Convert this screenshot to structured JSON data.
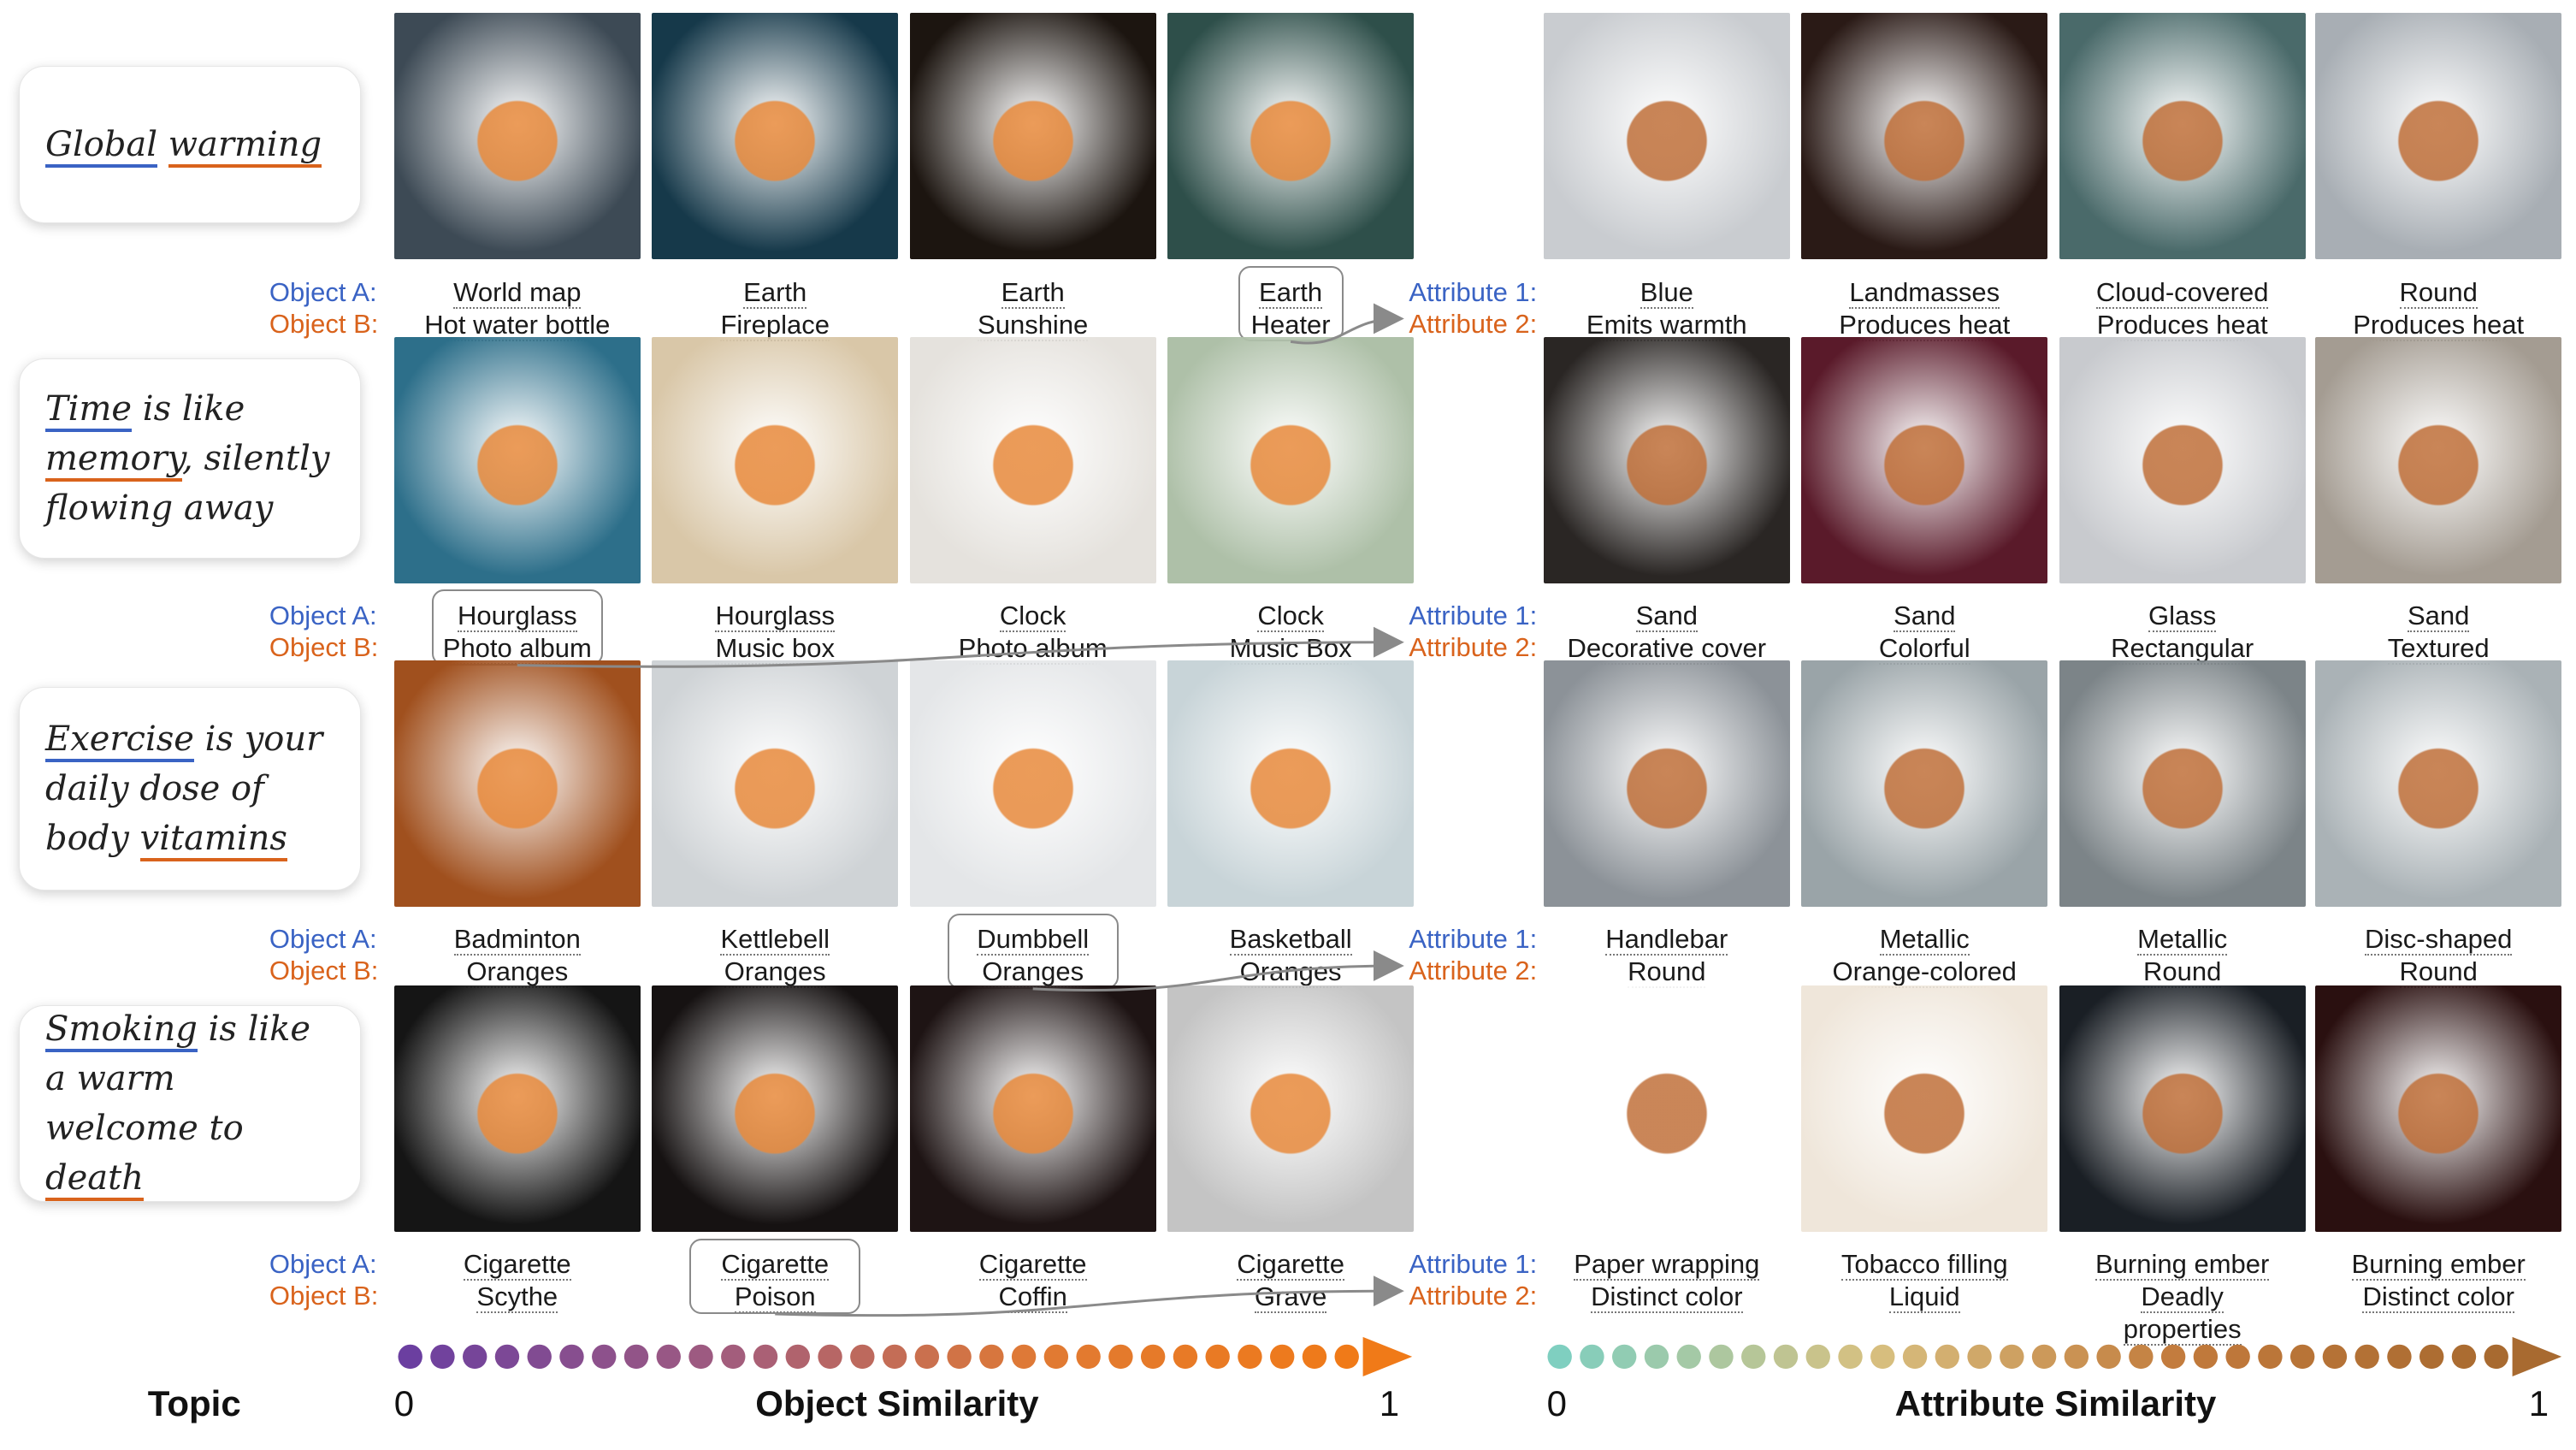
{
  "labels": {
    "object_a": "Object A:",
    "object_b": "Object B:",
    "attribute_1": "Attribute 1:",
    "attribute_2": "Attribute 2:"
  },
  "rows": [
    {
      "topic": [
        {
          "text": "Global",
          "u": "blue"
        },
        {
          "text": " "
        },
        {
          "text": "warming",
          "u": "orange"
        }
      ],
      "objects": [
        {
          "a": "World map",
          "b": "Hot water bottle",
          "icon": "bottle-map-icon",
          "bg": "#3d4a55"
        },
        {
          "a": "Earth",
          "b": "Fireplace",
          "icon": "earth-fireplace-icon",
          "bg": "#16394a"
        },
        {
          "a": "Earth",
          "b": "Sunshine",
          "icon": "earth-sun-icon",
          "bg": "#1c1510"
        },
        {
          "a": "Earth",
          "b": "Heater",
          "icon": "earth-heater-icon",
          "bg": "#2e4f4a"
        }
      ],
      "attributes": [
        {
          "a": "Blue",
          "b": "Emits warmth",
          "icon": "blue-flame-globe-icon",
          "bg": "#c9ccd0"
        },
        {
          "a": "Landmasses",
          "b": "Produces heat",
          "icon": "glowing-globe-icon",
          "bg": "#2a1a16"
        },
        {
          "a": "Cloud-covered",
          "b": "Produces heat",
          "icon": "burning-globe-icon",
          "bg": "#4a6a6a"
        },
        {
          "a": "Round",
          "b": "Produces heat",
          "icon": "heater-globe-icon",
          "bg": "#a8aeb4"
        }
      ],
      "highlight_index": 3,
      "extra_b": ""
    },
    {
      "topic": [
        {
          "text": "Time",
          "u": "blue"
        },
        {
          "text": " is like "
        },
        {
          "text": "memory",
          "u": "orange"
        },
        {
          "text": ", silently flowing away"
        }
      ],
      "objects": [
        {
          "a": "Hourglass",
          "b": "Photo album",
          "icon": "hourglass-album-icon",
          "bg": "#2d6f8a"
        },
        {
          "a": "Hourglass",
          "b": "Music box",
          "icon": "hourglass-musicbox-icon",
          "bg": "#d9c7a8"
        },
        {
          "a": "Clock",
          "b": "Photo album",
          "icon": "clock-album-icon",
          "bg": "#e5e2dd"
        },
        {
          "a": "Clock",
          "b": "Music Box",
          "icon": "clock-musicbox-icon",
          "bg": "#aec0a8"
        }
      ],
      "attributes": [
        {
          "a": "Sand",
          "b": "Decorative cover",
          "icon": "hourglass-book-icon",
          "bg": "#2a2624"
        },
        {
          "a": "Sand",
          "b": "Colorful",
          "icon": "hourglass-colorful-icon",
          "bg": "#5a1a2a"
        },
        {
          "a": "Glass",
          "b": "Rectangular",
          "icon": "glass-hourglass-icon",
          "bg": "#c8cace"
        },
        {
          "a": "Sand",
          "b": "Textured",
          "icon": "textured-hourglass-icon",
          "bg": "#a49c92"
        }
      ],
      "highlight_index": 0,
      "extra_b": ""
    },
    {
      "topic": [
        {
          "text": "Exercise",
          "u": "blue"
        },
        {
          "text": " is your daily dose of body "
        },
        {
          "text": "vitamins",
          "u": "orange"
        }
      ],
      "objects": [
        {
          "a": "Badminton",
          "b": "Oranges",
          "icon": "shuttlecock-orange-icon",
          "bg": "#a0501e"
        },
        {
          "a": "Kettlebell",
          "b": "Oranges",
          "icon": "kettlebell-orange-icon",
          "bg": "#cfd3d6"
        },
        {
          "a": "Dumbbell",
          "b": "Oranges",
          "icon": "dumbbell-orange-icon",
          "bg": "#e4e6e8"
        },
        {
          "a": "Basketball",
          "b": "Oranges",
          "icon": "basketball-orange-icon",
          "bg": "#c8d4d8"
        }
      ],
      "attributes": [
        {
          "a": "Handlebar",
          "b": "Round",
          "icon": "orange-handlebar-icon",
          "bg": "#8c9298"
        },
        {
          "a": "Metallic",
          "b": "Orange-colored",
          "icon": "orange-dumbbell-icon",
          "bg": "#9aa4a8"
        },
        {
          "a": "Metallic",
          "b": "Round",
          "icon": "metal-dumbbell-icon",
          "bg": "#7c8488"
        },
        {
          "a": "Disc-shaped",
          "b": "Round",
          "icon": "disc-dumbbell-icon",
          "bg": "#aab2b6"
        }
      ],
      "highlight_index": 2,
      "extra_b": ""
    },
    {
      "topic": [
        {
          "text": "Smoking",
          "u": "blue"
        },
        {
          "text": " is like a warm welcome to "
        },
        {
          "text": "death",
          "u": "orange"
        }
      ],
      "objects": [
        {
          "a": "Cigarette",
          "b": "Scythe",
          "icon": "cigarette-scythe-icon",
          "bg": "#151515"
        },
        {
          "a": "Cigarette",
          "b": "Poison",
          "icon": "cigarette-poison-icon",
          "bg": "#161212"
        },
        {
          "a": "Cigarette",
          "b": "Coffin",
          "icon": "cigarette-coffin-icon",
          "bg": "#1e1414"
        },
        {
          "a": "Cigarette",
          "b": "Grave",
          "icon": "cigarette-grave-icon",
          "bg": "#c4c4c4"
        }
      ],
      "attributes": [
        {
          "a": "Paper wrapping",
          "b": "Distinct color",
          "icon": "red-cigarettes-icon",
          "bg": "#ffffff"
        },
        {
          "a": "Tobacco filling",
          "b": "Liquid",
          "icon": "skull-cigarette-icon",
          "bg": "#efe6da"
        },
        {
          "a": "Burning ember",
          "b": "Deadly",
          "icon": "smoke-skull-icon",
          "bg": "#1a1f25"
        },
        {
          "a": "Burning ember",
          "b": "Distinct color",
          "icon": "red-skull-icon",
          "bg": "#2a1010"
        }
      ],
      "highlight_index": 1,
      "extra_b": "properties"
    }
  ],
  "footer": {
    "topic_label": "Topic",
    "object_axis": {
      "title": "Object Similarity",
      "min": "0",
      "max": "1"
    },
    "attribute_axis": {
      "title": "Attribute Similarity",
      "min": "0",
      "max": "1"
    },
    "object_gradient": [
      "#6b3fa0",
      "#a15c7f",
      "#e07a34",
      "#f07a18"
    ],
    "attribute_gradient": [
      "#7fcfc0",
      "#d8c080",
      "#c27a3c",
      "#a86a30"
    ]
  },
  "colors": {
    "object_a": "#3a63c4",
    "object_b": "#d9631c"
  }
}
